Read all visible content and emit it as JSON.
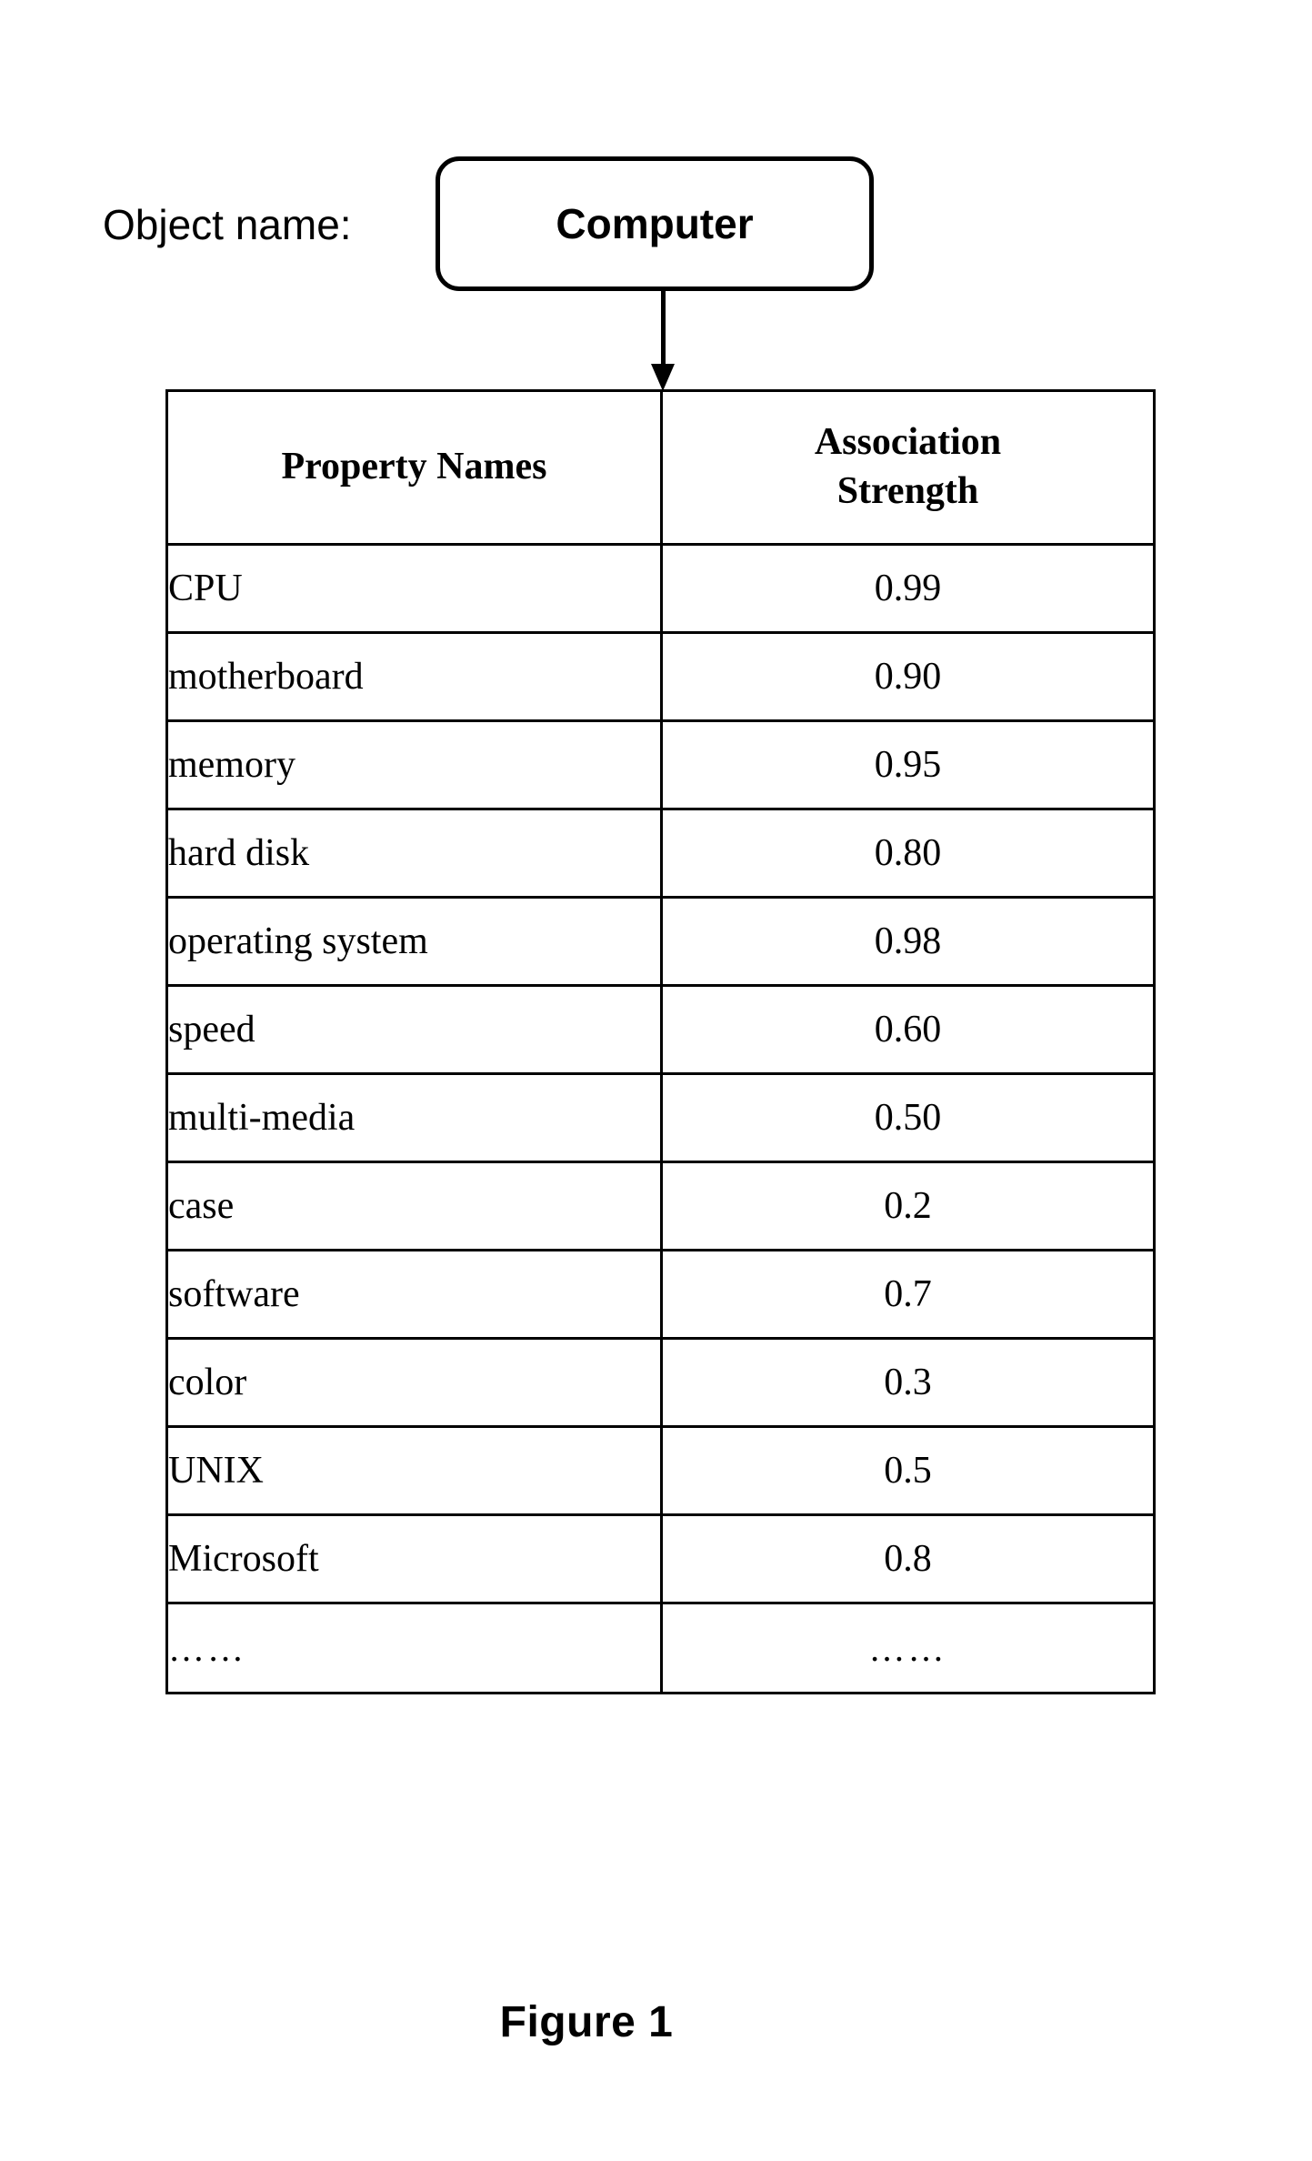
{
  "object": {
    "label": "Object name:",
    "value": "Computer"
  },
  "connector": {
    "icon": "down-arrow"
  },
  "table": {
    "columns": [
      "Property Names",
      "Association Strength"
    ],
    "column_header_lines": {
      "col1": "Property Names",
      "col2_line1": "Association",
      "col2_line2": "Strength"
    },
    "rows": [
      {
        "property": "CPU",
        "strength": "0.99"
      },
      {
        "property": "motherboard",
        "strength": "0.90"
      },
      {
        "property": "memory",
        "strength": "0.95"
      },
      {
        "property": "hard disk",
        "strength": "0.80"
      },
      {
        "property": "operating system",
        "strength": "0.98"
      },
      {
        "property": "speed",
        "strength": "0.60"
      },
      {
        "property": "multi-media",
        "strength": "0.50"
      },
      {
        "property": "case",
        "strength": "0.2"
      },
      {
        "property": "software",
        "strength": "0.7"
      },
      {
        "property": "color",
        "strength": "0.3"
      },
      {
        "property": "UNIX",
        "strength": "0.5"
      },
      {
        "property": "Microsoft",
        "strength": "0.8"
      },
      {
        "property": "……",
        "strength": "……"
      }
    ]
  },
  "caption": {
    "text": "Figure 1"
  },
  "colors": {
    "ink": "#000000",
    "paper": "#ffffff"
  },
  "chart_data": {
    "type": "table",
    "title": "Figure 1",
    "categories": [
      "CPU",
      "motherboard",
      "memory",
      "hard disk",
      "operating system",
      "speed",
      "multi-media",
      "case",
      "software",
      "color",
      "UNIX",
      "Microsoft"
    ],
    "values": [
      0.99,
      0.9,
      0.95,
      0.8,
      0.98,
      0.6,
      0.5,
      0.2,
      0.7,
      0.3,
      0.5,
      0.8
    ],
    "xlabel": "Property Names",
    "ylabel": "Association Strength",
    "ylim": [
      0,
      1
    ]
  }
}
